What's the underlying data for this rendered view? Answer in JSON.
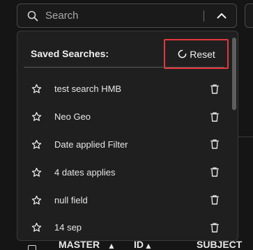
{
  "search": {
    "placeholder": "Search"
  },
  "saved_searches": {
    "title": "Saved Searches:",
    "reset_label": "Reset",
    "items": [
      {
        "label": "test search HMB"
      },
      {
        "label": "Neo Geo"
      },
      {
        "label": "Date applied Filter"
      },
      {
        "label": "4 dates applies"
      },
      {
        "label": "null field"
      },
      {
        "label": "14 sep"
      }
    ]
  },
  "table_header": {
    "columns": [
      "MASTER",
      "ID",
      "SUBJECT"
    ]
  },
  "icons": {
    "search": "search-icon",
    "chevron": "chevron-up-icon",
    "reset": "reset-icon",
    "star": "star-outline-icon",
    "trash": "trash-icon",
    "sort": "sort-arrow-icon"
  },
  "colors": {
    "background": "#151515",
    "panel": "#1f1f1f",
    "highlight_border": "#e5383b",
    "text": "#e8e8e8"
  }
}
